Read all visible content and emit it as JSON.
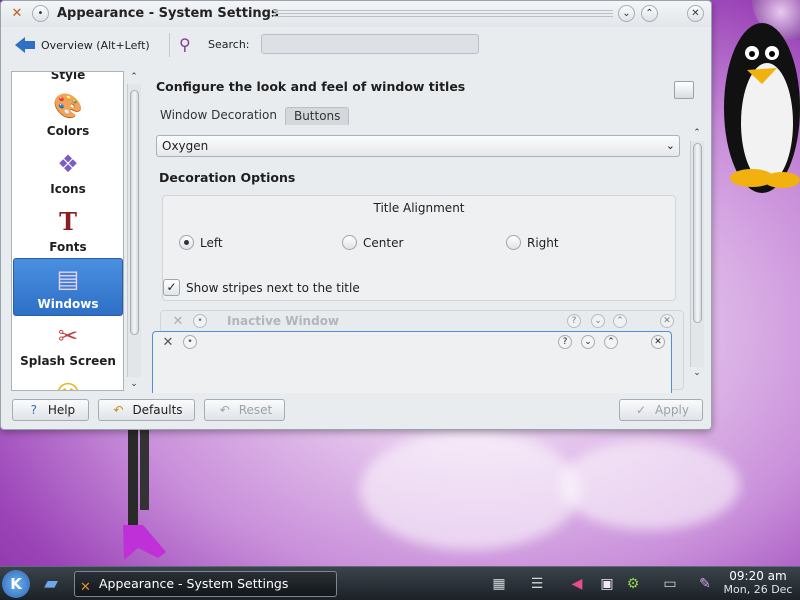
{
  "window": {
    "title": "Appearance - System Settings"
  },
  "toolbar": {
    "overview_label": "Overview (Alt+Left)",
    "search_label": "Search:",
    "search_value": ""
  },
  "sidebar": {
    "items": [
      {
        "label": "Style",
        "icon": "style-icon"
      },
      {
        "label": "Colors",
        "icon": "colors-icon"
      },
      {
        "label": "Icons",
        "icon": "icons-icon"
      },
      {
        "label": "Fonts",
        "icon": "fonts-icon"
      },
      {
        "label": "Windows",
        "icon": "windows-icon",
        "active": true
      },
      {
        "label": "Splash Screen",
        "icon": "splash-screen-icon"
      }
    ]
  },
  "main": {
    "heading": "Configure the look and feel of window titles",
    "tabs": [
      {
        "label": "Window Decoration",
        "active": true
      },
      {
        "label": "Buttons",
        "active": false
      }
    ],
    "decoration_value": "Oxygen",
    "decoration_options_title": "Decoration Options",
    "title_alignment_label": "Title Alignment",
    "alignment_options": [
      {
        "label": "Left",
        "checked": true
      },
      {
        "label": "Center",
        "checked": false
      },
      {
        "label": "Right",
        "checked": false
      }
    ],
    "stripes_label": "Show stripes next to the title",
    "stripes_checked": true,
    "preview_inactive_title": "Inactive Window"
  },
  "buttons": {
    "help": "Help",
    "defaults": "Defaults",
    "reset": "Reset",
    "apply": "Apply"
  },
  "taskbar": {
    "task_title": "Appearance - System Settings",
    "clock_time": "09:20 am",
    "clock_date": "Mon, 26 Dec"
  },
  "colors": {
    "accent": "#2e6fc7",
    "desktop": "#b060d0",
    "taskbar": "#1b2126"
  }
}
